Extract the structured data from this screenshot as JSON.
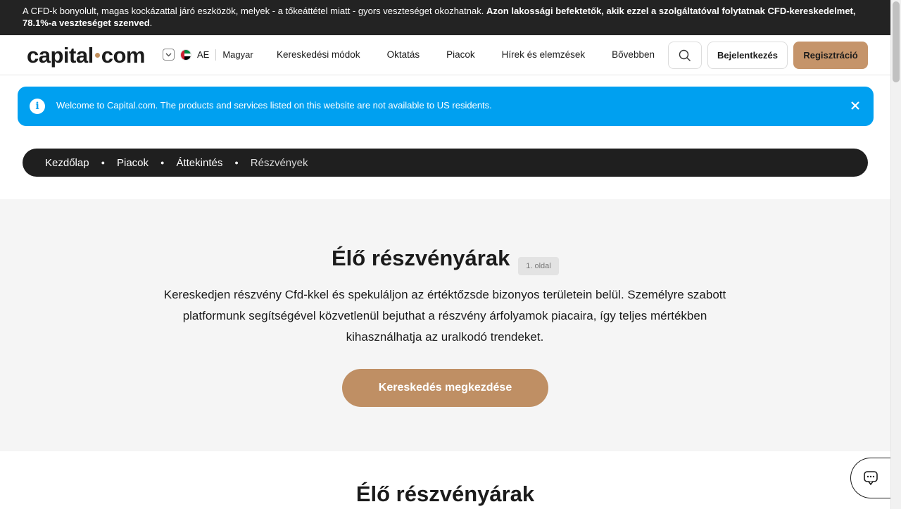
{
  "risk_warning": {
    "text": "A CFD-k bonyolult, magas kockázattal járó eszközök, melyek - a tőkeáttétel miatt - gyors veszteséget okozhatnak. ",
    "bold": "Azon lakossági befektetők, akik ezzel a szolgáltatóval folytatnak CFD-kereskedelmet, 78.1%-a veszteséget szenved",
    "tail": "."
  },
  "header": {
    "logo_left": "capital",
    "logo_right": "com",
    "region_code": "AE",
    "language": "Magyar",
    "nav": [
      "Kereskedési módok",
      "Oktatás",
      "Piacok",
      "Hírek és elemzések",
      "Bővebben"
    ],
    "login_label": "Bejelentkezés",
    "register_label": "Regisztráció"
  },
  "notice": {
    "text": "Welcome to Capital.com. The products and services listed on this website are not available to US residents."
  },
  "breadcrumb": [
    "Kezdőlap",
    "Piacok",
    "Áttekintés",
    "Részvények"
  ],
  "hero": {
    "title": "Élő részvényárak",
    "page_badge": "1. oldal",
    "description": "Kereskedjen részvény Cfd-kkel és spekuláljon az értéktőzsde bizonyos területein belül. Személyre szabott platformunk segítségével közvetlenül bejuthat a részvény árfolyamok piacaira, így teljes mértékben kihasználhatja az uralkodó trendeket.",
    "cta_label": "Kereskedés megkezdése"
  },
  "second_section": {
    "title": "Élő részvényárak"
  },
  "colors": {
    "accent": "#c5946a",
    "notice": "#00a0f0",
    "dark": "#1f1f1f"
  }
}
